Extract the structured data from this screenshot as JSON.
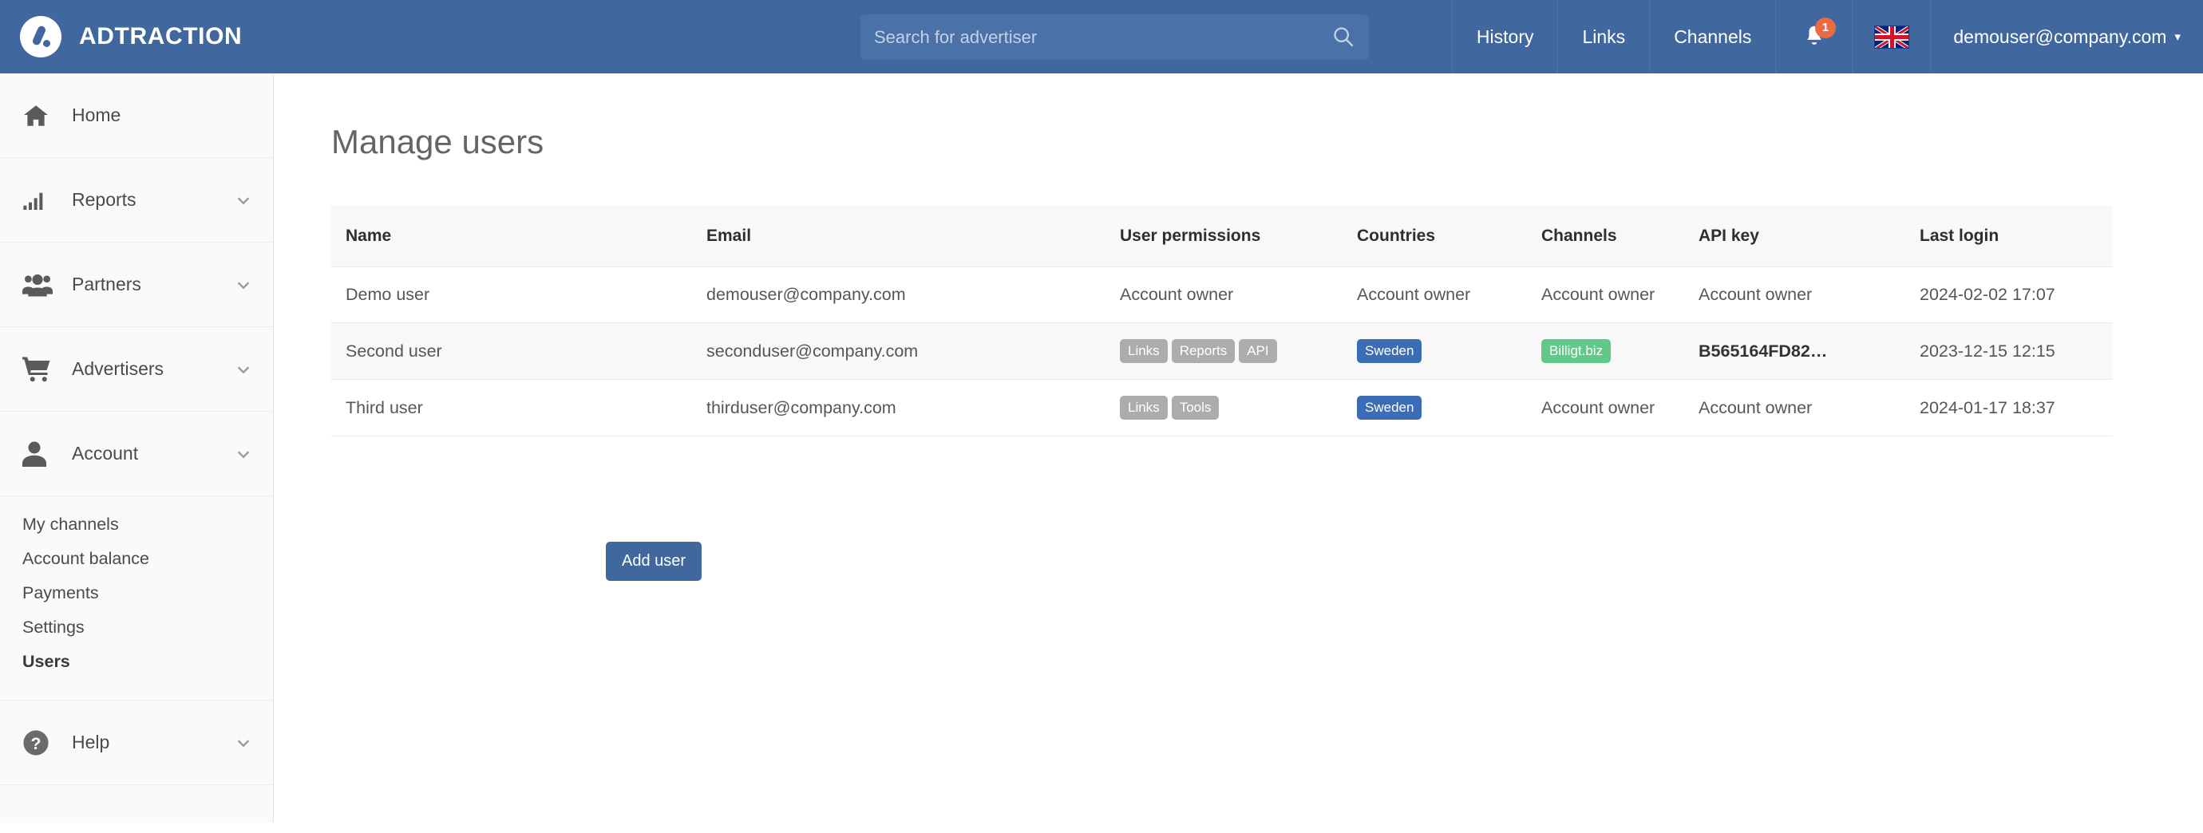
{
  "brand": {
    "name": "ADTRACTION",
    "logo_icon": "adtraction-logo-icon"
  },
  "search": {
    "placeholder": "Search for advertiser",
    "value": "",
    "icon": "search-icon"
  },
  "topnav": {
    "links": [
      {
        "label": "History"
      },
      {
        "label": "Links"
      },
      {
        "label": "Channels"
      }
    ],
    "notifications": {
      "icon": "bell-icon",
      "count": "1"
    },
    "language": {
      "icon": "uk-flag-icon"
    },
    "user": {
      "label": "demouser@company.com",
      "caret": "▾"
    }
  },
  "sidebar": {
    "items": [
      {
        "label": "Home",
        "icon": "home-icon",
        "expandable": false
      },
      {
        "label": "Reports",
        "icon": "bar-chart-icon",
        "expandable": true
      },
      {
        "label": "Partners",
        "icon": "people-group-icon",
        "expandable": true
      },
      {
        "label": "Advertisers",
        "icon": "shopping-cart-icon",
        "expandable": true
      },
      {
        "label": "Account",
        "icon": "user-icon",
        "expandable": true
      }
    ],
    "account_subitems": [
      {
        "label": "My channels",
        "active": false
      },
      {
        "label": "Account balance",
        "active": false
      },
      {
        "label": "Payments",
        "active": false
      },
      {
        "label": "Settings",
        "active": false
      },
      {
        "label": "Users",
        "active": true
      }
    ],
    "help": {
      "label": "Help",
      "icon": "question-circle-icon",
      "expandable": true
    }
  },
  "main": {
    "title": "Manage users",
    "add_user_label": "Add user",
    "table": {
      "headers": {
        "name": "Name",
        "email": "Email",
        "permissions": "User permissions",
        "countries": "Countries",
        "channels": "Channels",
        "api_key": "API key",
        "last_login": "Last login"
      },
      "rows": [
        {
          "name": "Demo user",
          "email": "demouser@company.com",
          "permissions_text": "Account owner",
          "permissions_chips": [],
          "countries_text": "Account owner",
          "countries_chips": [],
          "channels_text": "Account owner",
          "channels_chips": [],
          "api_key": "Account owner",
          "api_key_bold": false,
          "last_login": "2024-02-02 17:07"
        },
        {
          "name": "Second user",
          "email": "seconduser@company.com",
          "permissions_text": "",
          "permissions_chips": [
            "Links",
            "Reports",
            "API"
          ],
          "countries_text": "",
          "countries_chips": [
            "Sweden"
          ],
          "channels_text": "",
          "channels_chips": [
            "Billigt.biz"
          ],
          "api_key": "B565164FD82…",
          "api_key_bold": true,
          "last_login": "2023-12-15 12:15"
        },
        {
          "name": "Third user",
          "email": "thirduser@company.com",
          "permissions_text": "",
          "permissions_chips": [
            "Links",
            "Tools"
          ],
          "countries_text": "",
          "countries_chips": [
            "Sweden"
          ],
          "channels_text": "Account owner",
          "channels_chips": [],
          "api_key": "Account owner",
          "api_key_bold": false,
          "last_login": "2024-01-17 18:37"
        }
      ]
    }
  },
  "colors": {
    "brand_blue": "#41679f",
    "chip_gray": "#acacac",
    "chip_blue": "#3c6cb4",
    "chip_green": "#62c887",
    "badge_orange": "#ea6a42"
  }
}
